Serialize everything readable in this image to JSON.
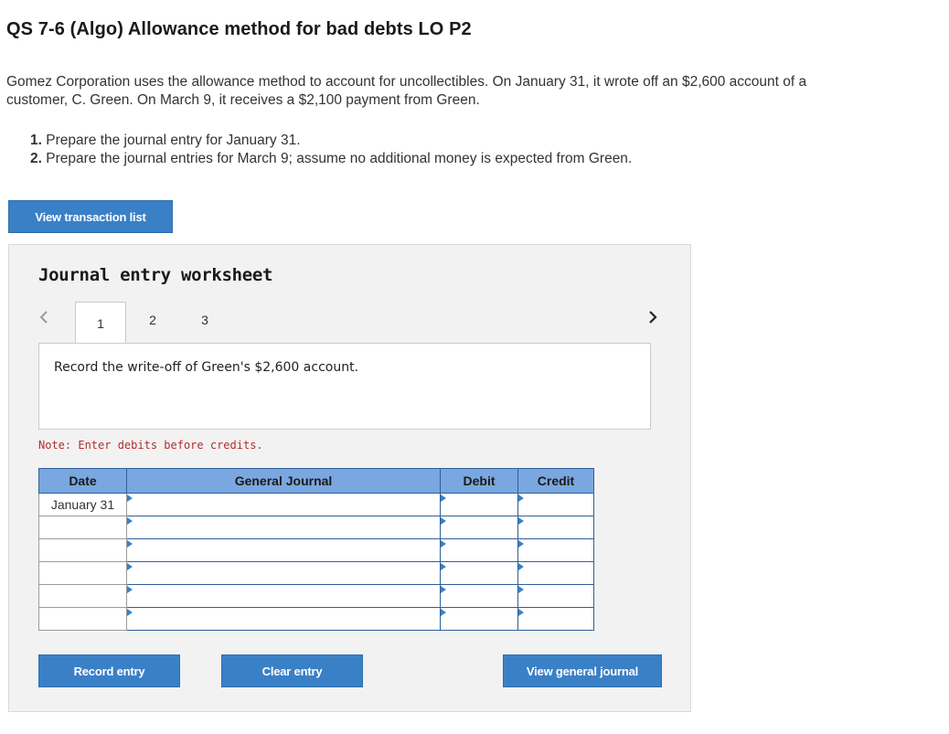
{
  "page": {
    "title": "QS 7-6 (Algo) Allowance method for bad debts LO P2",
    "intro_line1": "Gomez Corporation uses the allowance method to account for uncollectibles. On January 31, it wrote off an $2,600 account of a",
    "intro_line2": "customer, C. Green. On March 9, it receives a $2,100 payment from Green.",
    "steps": [
      {
        "num": "1.",
        "text": " Prepare the journal entry for January 31."
      },
      {
        "num": "2.",
        "text": " Prepare the journal entries for March 9; assume no additional money is expected from Green."
      }
    ],
    "view_transactions_label": "View transaction list"
  },
  "worksheet": {
    "title": "Journal entry worksheet",
    "tabs": [
      "1",
      "2",
      "3"
    ],
    "active_tab": 0,
    "description": "Record the write-off of Green's $2,600 account.",
    "note": "Note: Enter debits before credits.",
    "columns": {
      "date": "Date",
      "journal": "General Journal",
      "debit": "Debit",
      "credit": "Credit"
    },
    "rows": [
      {
        "date": "January 31",
        "account": "",
        "debit": "",
        "credit": ""
      },
      {
        "date": "",
        "account": "",
        "debit": "",
        "credit": ""
      },
      {
        "date": "",
        "account": "",
        "debit": "",
        "credit": ""
      },
      {
        "date": "",
        "account": "",
        "debit": "",
        "credit": ""
      },
      {
        "date": "",
        "account": "",
        "debit": "",
        "credit": ""
      },
      {
        "date": "",
        "account": "",
        "debit": "",
        "credit": ""
      }
    ],
    "buttons": {
      "record": "Record entry",
      "clear": "Clear entry",
      "view_journal": "View general journal"
    }
  },
  "colors": {
    "button": "#3a80c6",
    "table_header": "#7aa7df",
    "note": "#b32d2d"
  }
}
